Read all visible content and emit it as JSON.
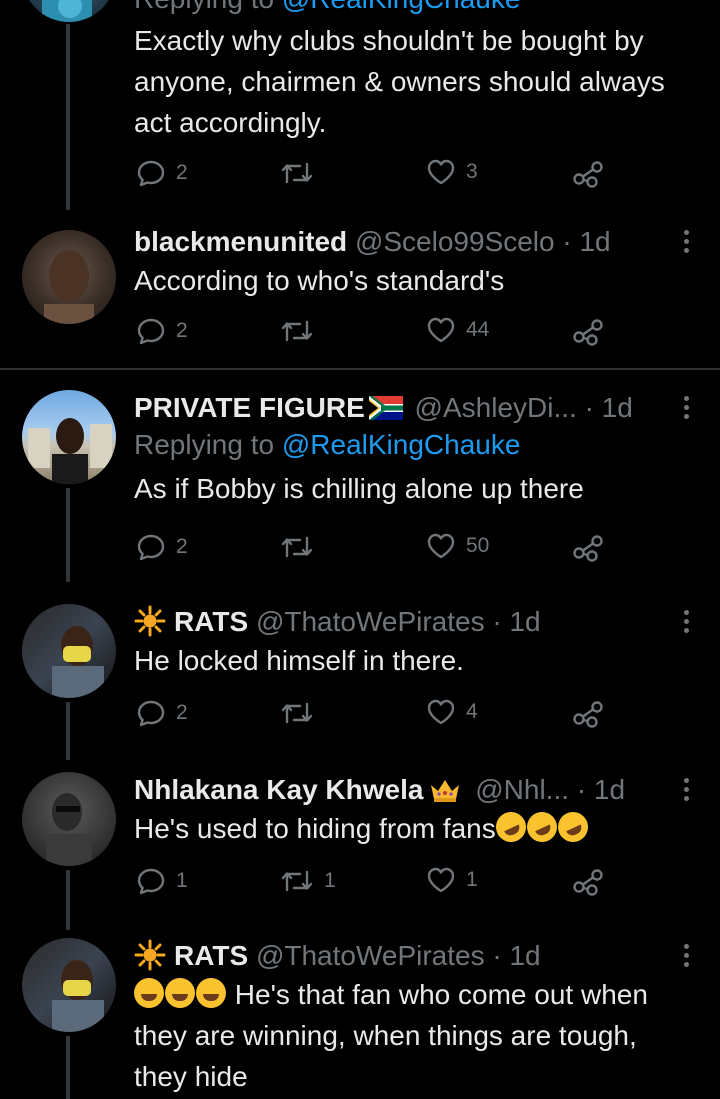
{
  "tweets": [
    {
      "id": "t1",
      "name": "",
      "handle": "",
      "time": "",
      "reply_label": "Replying to",
      "reply_mention": "@RealKingChauke",
      "text": "Exactly why clubs shouldn't be bought by anyone, chairmen & owners should always act accordingly.",
      "replies": "2",
      "retweets": "",
      "likes": "3"
    },
    {
      "id": "t2",
      "name": "blackmenunited",
      "handle": "@Scelo99Scelo · 1d",
      "text": "According to who's standard's",
      "replies": "2",
      "retweets": "",
      "likes": "44"
    },
    {
      "id": "t3",
      "name": "PRIVATE FIGURE",
      "handle": "@AshleyDi... · 1d",
      "reply_label": "Replying to",
      "reply_mention": "@RealKingChauke",
      "text": "As if Bobby is chilling alone up there",
      "replies": "2",
      "retweets": "",
      "likes": "50"
    },
    {
      "id": "t4",
      "name": "RATS",
      "handle": "@ThatoWePirates · 1d",
      "text": "He locked himself in there.",
      "replies": "2",
      "retweets": "",
      "likes": "4"
    },
    {
      "id": "t5",
      "name": "Nhlakana Kay Khwela",
      "handle": "@Nhl... · 1d",
      "text": "He's used to hiding from fans",
      "replies": "1",
      "retweets": "1",
      "likes": "1"
    },
    {
      "id": "t6",
      "name": "RATS",
      "handle": "@ThatoWePirates · 1d",
      "text_line1": "He's that fan who come out",
      "text_rest": "when they are winning, when things are tough, they hide"
    }
  ],
  "icons": {
    "reply": "reply-icon",
    "retweet": "retweet-icon",
    "like": "heart-icon",
    "share": "share-icon",
    "more": "more-icon"
  },
  "colors": {
    "background": "#000000",
    "text": "#e7e9ea",
    "secondary": "#71767b",
    "accent": "#1d9bf0",
    "divider": "#2f3336"
  }
}
